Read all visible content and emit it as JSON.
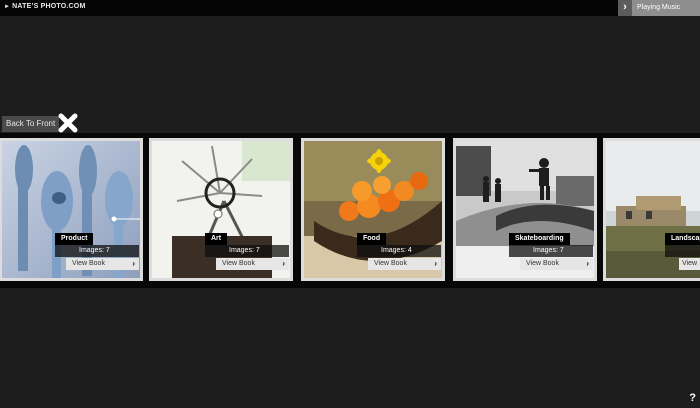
{
  "header": {
    "logo": "NATE’S PHOTO.COM",
    "music_label": "Playing Music"
  },
  "nav": {
    "back_label": "Back To Front"
  },
  "cards": [
    {
      "category": "Product",
      "images": "Images: 7",
      "view": "View Book"
    },
    {
      "category": "Art",
      "images": "Images: 7",
      "view": "View Book"
    },
    {
      "category": "Food",
      "images": "Images: 4",
      "view": "View Book"
    },
    {
      "category": "Skateboarding",
      "images": "Images: 7",
      "view": "View Book"
    },
    {
      "category": "Landscape",
      "images": "",
      "view": "View"
    }
  ],
  "footer": {
    "help": "?"
  },
  "colors": {
    "background": "#1d1d1d",
    "strip": "#070707",
    "card_frame": "#dcdcdc"
  }
}
